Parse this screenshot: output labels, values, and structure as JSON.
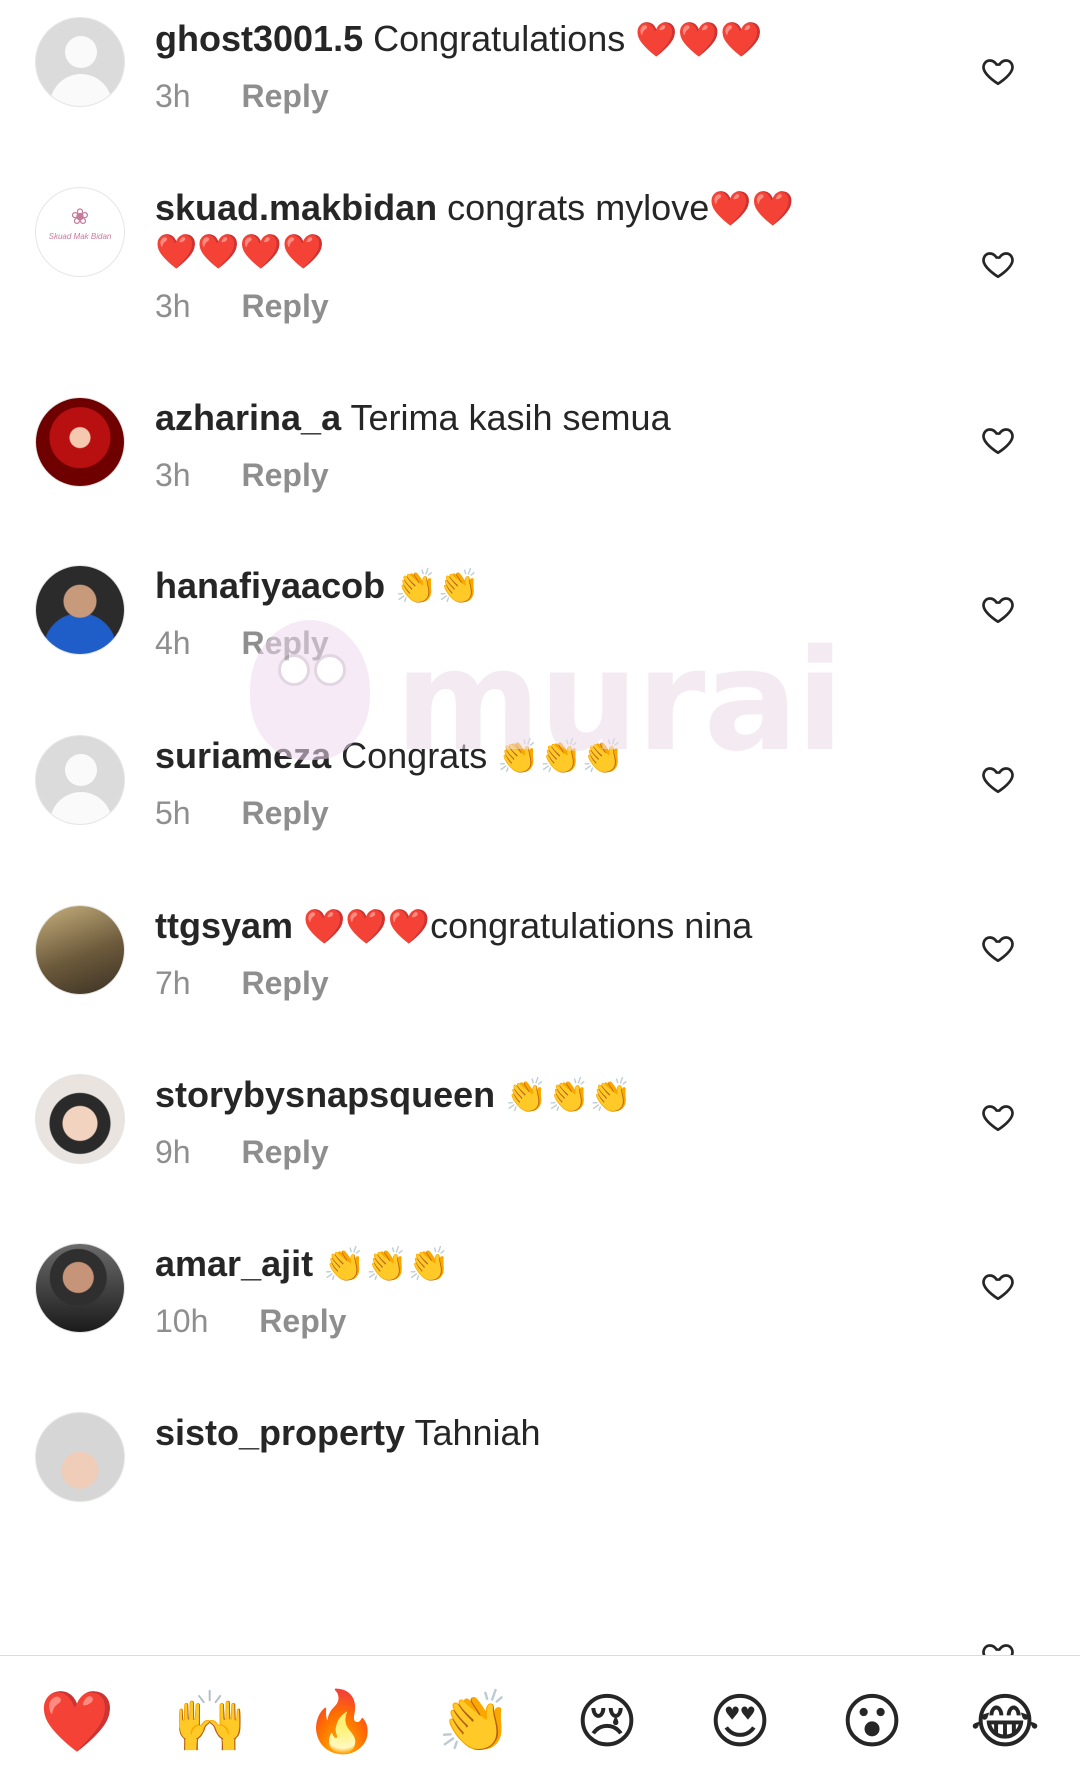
{
  "comments": [
    {
      "username": "ghost3001.5",
      "text": "Congratulations",
      "emoji": "❤️❤️❤️",
      "line2": "",
      "time": "3h",
      "reply": "Reply"
    },
    {
      "username": "skuad.makbidan",
      "text": "congrats mylove",
      "emoji": "❤️❤️",
      "line2": "❤️❤️❤️❤️",
      "time": "3h",
      "reply": "Reply"
    },
    {
      "username": "azharina_a",
      "text": "Terima kasih semua",
      "emoji": "",
      "line2": "",
      "time": "3h",
      "reply": "Reply"
    },
    {
      "username": "hanafiyaacob",
      "text": "",
      "emoji": "👏👏",
      "line2": "",
      "time": "4h",
      "reply": "Reply"
    },
    {
      "username": "suriameza",
      "text": "Congrats",
      "emoji": "👏👏👏",
      "line2": "",
      "time": "5h",
      "reply": "Reply"
    },
    {
      "username": "ttgsyam",
      "text": "",
      "emoji": "❤️❤️❤️",
      "text_after": "congratulations nina",
      "line2": "",
      "time": "7h",
      "reply": "Reply"
    },
    {
      "username": "storybysnapsqueen",
      "text": "",
      "emoji": "👏👏👏",
      "line2": "",
      "time": "9h",
      "reply": "Reply"
    },
    {
      "username": "amar_ajit",
      "text": "",
      "emoji": "👏👏👏",
      "line2": "",
      "time": "10h",
      "reply": "Reply"
    },
    {
      "username": "sisto_property",
      "text": "Tahniah",
      "emoji": "",
      "line2": "",
      "time": "",
      "reply": ""
    }
  ],
  "watermark": {
    "text": "murai"
  },
  "reactions": [
    "❤️",
    "🙌",
    "🔥",
    "👏",
    "😢",
    "😍",
    "😮",
    "😂"
  ]
}
